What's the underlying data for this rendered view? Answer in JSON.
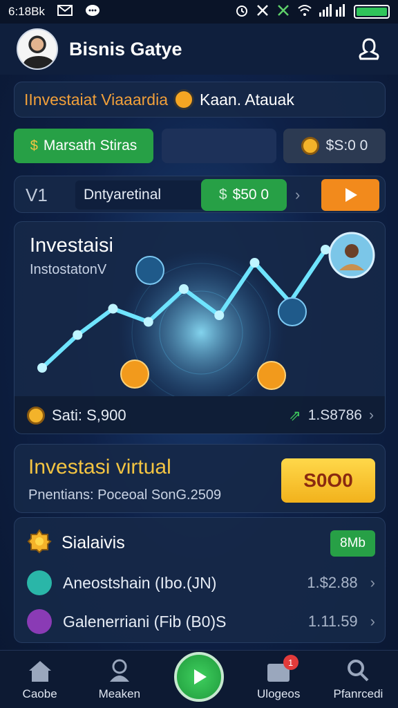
{
  "status_bar": {
    "time": "6:18Bk"
  },
  "header": {
    "title": "Bisnis Gatye"
  },
  "banner": {
    "text_left": "IInvestaiat Viaaardia",
    "text_right": "Kaan. Atauak"
  },
  "row2": {
    "green_button": "Marsath Stiras",
    "gray_button": "$S:0 0"
  },
  "row3": {
    "tag": "V1",
    "field": "Dntyaretinal",
    "green_button": "$50 0"
  },
  "chart_card": {
    "title": "Investaisi",
    "subtitle": "InstostatonV",
    "footer_label": "Sati: S,900",
    "footer_stat": "1.S8786"
  },
  "chart_data": {
    "type": "line",
    "title": "Investaisi",
    "series": [
      {
        "values": [
          0.1,
          0.35,
          0.55,
          0.45,
          0.7,
          0.5,
          0.9,
          0.6,
          1.0
        ]
      }
    ],
    "ylim": [
      0,
      1
    ],
    "grid": false
  },
  "virtual_card": {
    "title": "Investasi virtual",
    "description": "Pnentians: Poceoal SonG.2509",
    "amount": "S0O0"
  },
  "list": {
    "header_label": "Sialaivis",
    "header_pill": "8Mb",
    "items": [
      {
        "name": "Aneostshain (Ibo.(JN)",
        "value": "1.$2.88",
        "icon_color": "#2ab6a8"
      },
      {
        "name": "Galenerriani (Fib (B0)S",
        "value": "1.11.59",
        "icon_color": "#8a3bb5"
      }
    ]
  },
  "nav": {
    "items": [
      "Caobe",
      "Meaken",
      "Ulogeos",
      "Pfanrcedi"
    ],
    "badge_count": "1"
  },
  "colors": {
    "accent_green": "#27a046",
    "accent_orange": "#f28a1c",
    "accent_gold": "#f4c542",
    "background": "#0e2148"
  }
}
